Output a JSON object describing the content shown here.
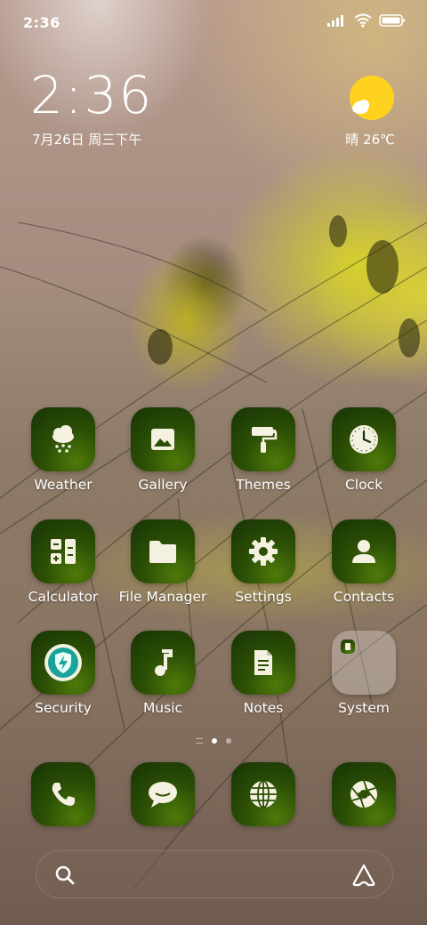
{
  "status_bar": {
    "time": "2:36",
    "icons": [
      "signal-icon",
      "wifi-icon",
      "battery-icon"
    ]
  },
  "clock_widget": {
    "time": "2:36",
    "date": "7月26日 周三下午"
  },
  "weather_widget": {
    "icon": "sunny-cloud-icon",
    "text": "晴 26℃"
  },
  "apps": [
    {
      "label": "Weather",
      "icon": "weather-snow-cloud-icon"
    },
    {
      "label": "Gallery",
      "icon": "gallery-image-icon"
    },
    {
      "label": "Themes",
      "icon": "paint-roller-icon"
    },
    {
      "label": "Clock",
      "icon": "clock-icon"
    },
    {
      "label": "Calculator",
      "icon": "calculator-icon"
    },
    {
      "label": "File Manager",
      "icon": "folder-icon"
    },
    {
      "label": "Settings",
      "icon": "gear-icon"
    },
    {
      "label": "Contacts",
      "icon": "person-icon"
    },
    {
      "label": "Security",
      "icon": "shield-bolt-icon"
    },
    {
      "label": "Music",
      "icon": "music-note-icon"
    },
    {
      "label": "Notes",
      "icon": "note-document-icon"
    },
    {
      "label": "System",
      "icon": "folder-icon"
    }
  ],
  "dock": [
    {
      "icon": "phone-icon"
    },
    {
      "icon": "message-bubble-icon"
    },
    {
      "icon": "globe-icon"
    },
    {
      "icon": "camera-aperture-icon"
    }
  ],
  "page_indicator": {
    "pages": 2,
    "active": 1
  },
  "search_bar": {
    "left_icon": "search-icon",
    "right_icon": "assistant-icon"
  },
  "colors": {
    "icon_bg_dark": "#173306",
    "icon_bg_light": "#4f7a0a",
    "glyph": "#f4f1e0"
  }
}
